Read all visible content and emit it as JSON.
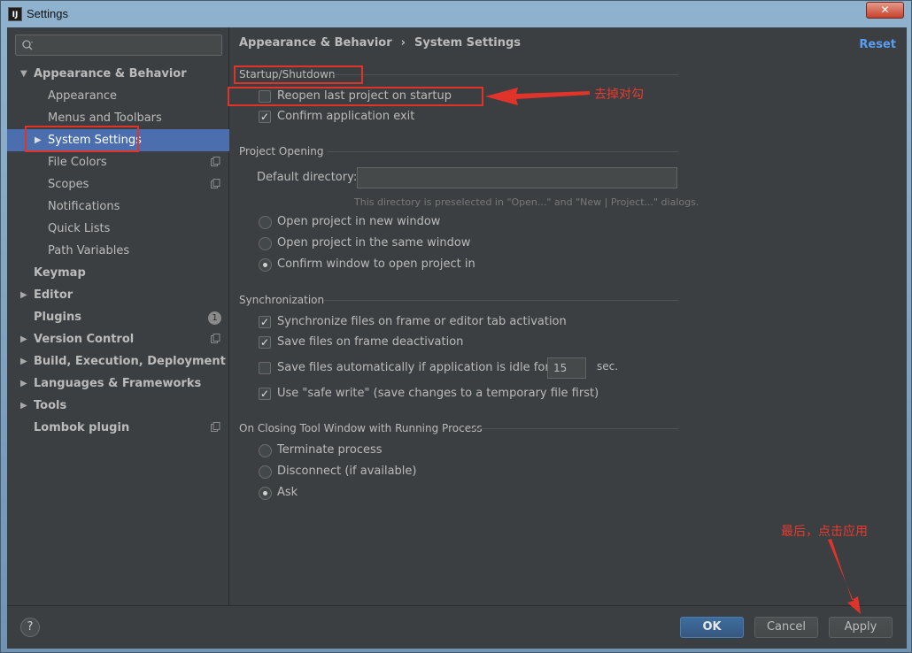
{
  "window": {
    "title": "Settings",
    "app_icon": "IJ",
    "close_label": "✕"
  },
  "search": {
    "placeholder": ""
  },
  "sidebar": {
    "items": [
      {
        "label": "Appearance & Behavior",
        "arrow": "▼"
      },
      {
        "label": "Appearance"
      },
      {
        "label": "Menus and Toolbars"
      },
      {
        "label": "System Settings",
        "arrow": "▶"
      },
      {
        "label": "File Colors"
      },
      {
        "label": "Scopes"
      },
      {
        "label": "Notifications"
      },
      {
        "label": "Quick Lists"
      },
      {
        "label": "Path Variables"
      },
      {
        "label": "Keymap"
      },
      {
        "label": "Editor",
        "arrow": "▶"
      },
      {
        "label": "Plugins",
        "badge": "1"
      },
      {
        "label": "Version Control",
        "arrow": "▶"
      },
      {
        "label": "Build, Execution, Deployment",
        "arrow": "▶"
      },
      {
        "label": "Languages & Frameworks",
        "arrow": "▶"
      },
      {
        "label": "Tools",
        "arrow": "▶"
      },
      {
        "label": "Lombok plugin"
      }
    ]
  },
  "breadcrumb": {
    "parent": "Appearance & Behavior",
    "separator": "›",
    "current": "System Settings"
  },
  "reset_label": "Reset",
  "startup": {
    "title": "Startup/Shutdown",
    "reopen_label": "Reopen last project on startup",
    "reopen_checked": false,
    "confirm_exit_label": "Confirm application exit",
    "confirm_exit_checked": true
  },
  "project_opening": {
    "title": "Project Opening",
    "default_dir_label": "Default directory:",
    "default_dir_value": "",
    "hint": "This directory is preselected in \"Open...\" and \"New | Project...\" dialogs.",
    "options": [
      {
        "label": "Open project in new window",
        "checked": false
      },
      {
        "label": "Open project in the same window",
        "checked": false
      },
      {
        "label": "Confirm window to open project in",
        "checked": true
      }
    ]
  },
  "sync": {
    "title": "Synchronization",
    "sync_files_label": "Synchronize files on frame or editor tab activation",
    "save_deactivation_label": "Save files on frame deactivation",
    "save_idle_label": "Save files automatically if application is idle for",
    "idle_value": "15",
    "idle_unit": "sec.",
    "safe_write_label": "Use \"safe write\" (save changes to a temporary file first)"
  },
  "closing": {
    "title": "On Closing Tool Window with Running Process",
    "options": [
      {
        "label": "Terminate process",
        "checked": false
      },
      {
        "label": "Disconnect (if available)",
        "checked": false
      },
      {
        "label": "Ask",
        "checked": true
      }
    ]
  },
  "buttons": {
    "help": "?",
    "ok": "OK",
    "cancel": "Cancel",
    "apply": "Apply"
  },
  "annotations": {
    "uncheck_note": "去掉对勾",
    "apply_note": "最后，点击应用"
  },
  "colors": {
    "accent": "#4b6eaf",
    "link": "#589df6",
    "annotation": "#e0342b"
  }
}
